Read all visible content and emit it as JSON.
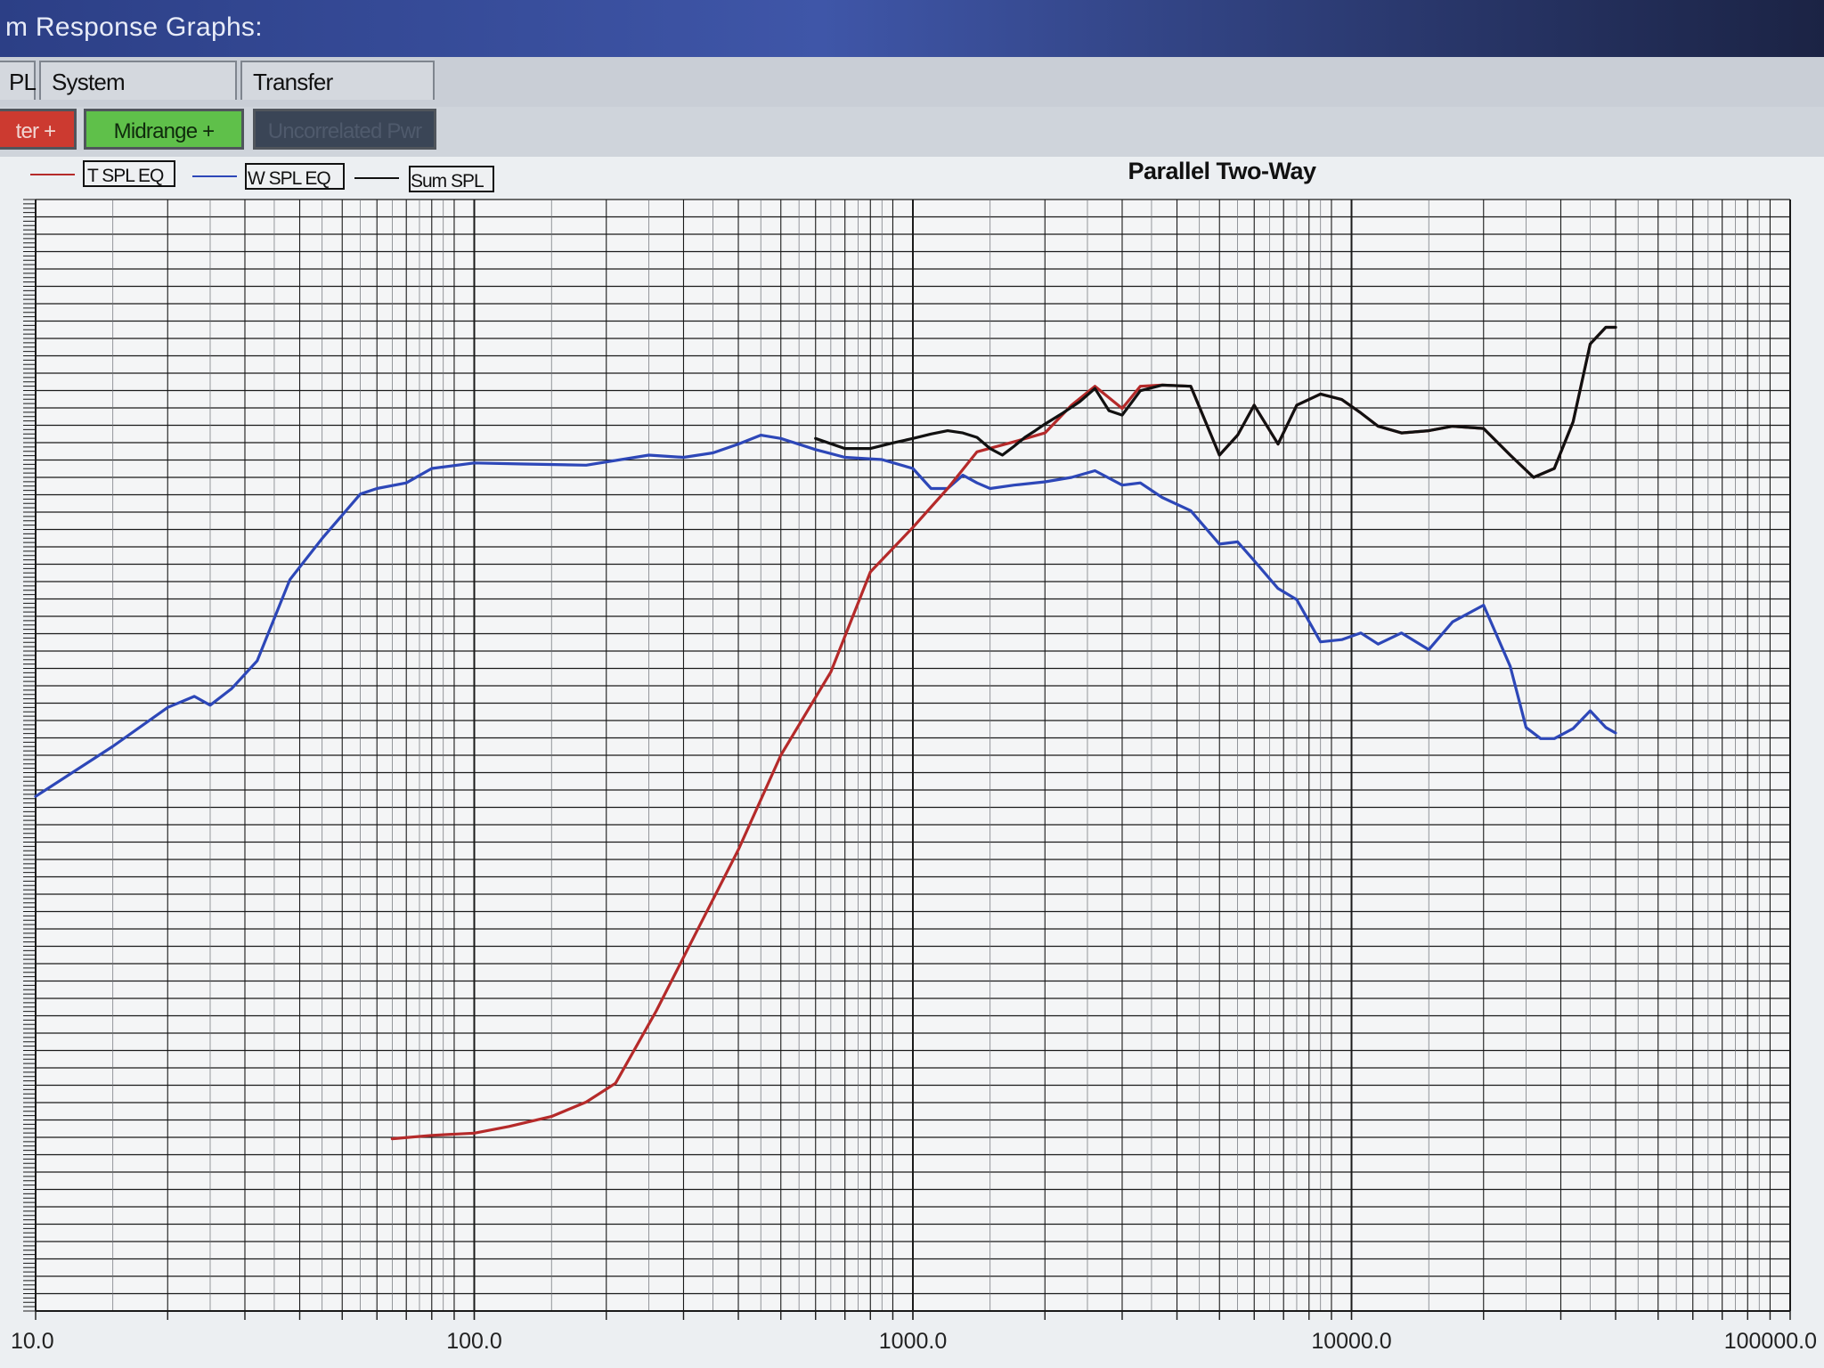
{
  "window": {
    "title": "m Response Graphs:"
  },
  "tabs": [
    {
      "label": "PL"
    },
    {
      "label": "System Impedance"
    },
    {
      "label": "Transfer Functions"
    }
  ],
  "buttons": [
    {
      "label": "ter +",
      "color": "#cc3a30"
    },
    {
      "label": "Midrange +",
      "color": "#5fc04a"
    },
    {
      "label": "Uncorrelated Pwr",
      "color": "#3a4556"
    }
  ],
  "chart_data": {
    "type": "line",
    "title": "Parallel Two-Way",
    "xscale": "log",
    "xlim": [
      10,
      100000
    ],
    "ylim": [
      0,
      1
    ],
    "x_tick_labels": [
      "10.0",
      "100.0",
      "1000.0",
      "10000.0",
      "100000.0"
    ],
    "grid": true,
    "legend_position": "top-left",
    "legend": [
      {
        "name": "T SPL EQ",
        "color": "#b52a2a"
      },
      {
        "name": "W SPL EQ",
        "color": "#2d47b8"
      },
      {
        "name": "Sum SPL",
        "color": "#111111"
      }
    ],
    "series": [
      {
        "name": "W SPL EQ",
        "color": "#2d47b8",
        "x": [
          10,
          15,
          20,
          23,
          25,
          28,
          32,
          38,
          45,
          55,
          60,
          70,
          80,
          100,
          130,
          180,
          250,
          300,
          350,
          400,
          450,
          500,
          600,
          700,
          850,
          1000,
          1100,
          1200,
          1300,
          1400,
          1500,
          1700,
          2000,
          2300,
          2600,
          3000,
          3300,
          3700,
          4300,
          5000,
          5500,
          6000,
          6800,
          7500,
          8500,
          9500,
          10500,
          11500,
          13000,
          15000,
          17000,
          20000,
          23000,
          25000,
          27000,
          29000,
          32000,
          35000,
          38000,
          40000
        ],
        "y": [
          0.463,
          0.508,
          0.543,
          0.553,
          0.545,
          0.56,
          0.585,
          0.658,
          0.695,
          0.735,
          0.74,
          0.745,
          0.758,
          0.763,
          0.762,
          0.761,
          0.77,
          0.768,
          0.772,
          0.78,
          0.788,
          0.785,
          0.775,
          0.768,
          0.766,
          0.758,
          0.74,
          0.74,
          0.752,
          0.745,
          0.74,
          0.743,
          0.746,
          0.75,
          0.756,
          0.743,
          0.745,
          0.732,
          0.72,
          0.69,
          0.692,
          0.675,
          0.65,
          0.64,
          0.602,
          0.604,
          0.61,
          0.6,
          0.61,
          0.595,
          0.62,
          0.635,
          0.58,
          0.525,
          0.515,
          0.515,
          0.524,
          0.54,
          0.525,
          0.52
        ]
      },
      {
        "name": "T SPL EQ",
        "color": "#b52a2a",
        "x": [
          65,
          80,
          100,
          120,
          150,
          180,
          210,
          260,
          320,
          400,
          500,
          650,
          800,
          1000,
          1200,
          1400,
          1700,
          2000,
          2300,
          2600,
          3000,
          3300,
          3700,
          4300,
          5000,
          5500,
          6000,
          6800,
          7500,
          8500,
          9500,
          10500,
          11500,
          13000,
          15000,
          17000,
          20000,
          23000,
          26000,
          29000,
          32000,
          35000,
          38000,
          40000
        ],
        "y": [
          0.155,
          0.158,
          0.16,
          0.166,
          0.175,
          0.188,
          0.205,
          0.27,
          0.34,
          0.415,
          0.5,
          0.575,
          0.665,
          0.705,
          0.74,
          0.773,
          0.782,
          0.79,
          0.815,
          0.832,
          0.812,
          0.832,
          0.833,
          0.832,
          0.77,
          0.788,
          0.815,
          0.78,
          0.815,
          0.825,
          0.82,
          0.808,
          0.796,
          0.79,
          0.792,
          0.796,
          0.794,
          0.77,
          0.75,
          0.758,
          0.8,
          0.87,
          0.885,
          0.885
        ]
      },
      {
        "name": "Sum SPL",
        "color": "#111111",
        "x": [
          600,
          700,
          800,
          900,
          1000,
          1100,
          1200,
          1300,
          1400,
          1500,
          1600,
          1700,
          1800,
          1900,
          2000,
          2200,
          2400,
          2600,
          2800,
          3000,
          3300,
          3700,
          4300,
          5000,
          5500,
          6000,
          6800,
          7500,
          8500,
          9500,
          10500,
          11500,
          13000,
          15000,
          17000,
          20000,
          23000,
          26000,
          29000,
          32000,
          35000,
          38000,
          40000
        ],
        "y": [
          0.785,
          0.776,
          0.776,
          0.781,
          0.785,
          0.789,
          0.792,
          0.79,
          0.786,
          0.776,
          0.77,
          0.778,
          0.786,
          0.792,
          0.798,
          0.808,
          0.818,
          0.83,
          0.81,
          0.806,
          0.828,
          0.833,
          0.832,
          0.77,
          0.788,
          0.815,
          0.78,
          0.815,
          0.825,
          0.82,
          0.808,
          0.796,
          0.79,
          0.792,
          0.796,
          0.794,
          0.77,
          0.75,
          0.758,
          0.8,
          0.87,
          0.885,
          0.885
        ]
      }
    ]
  }
}
